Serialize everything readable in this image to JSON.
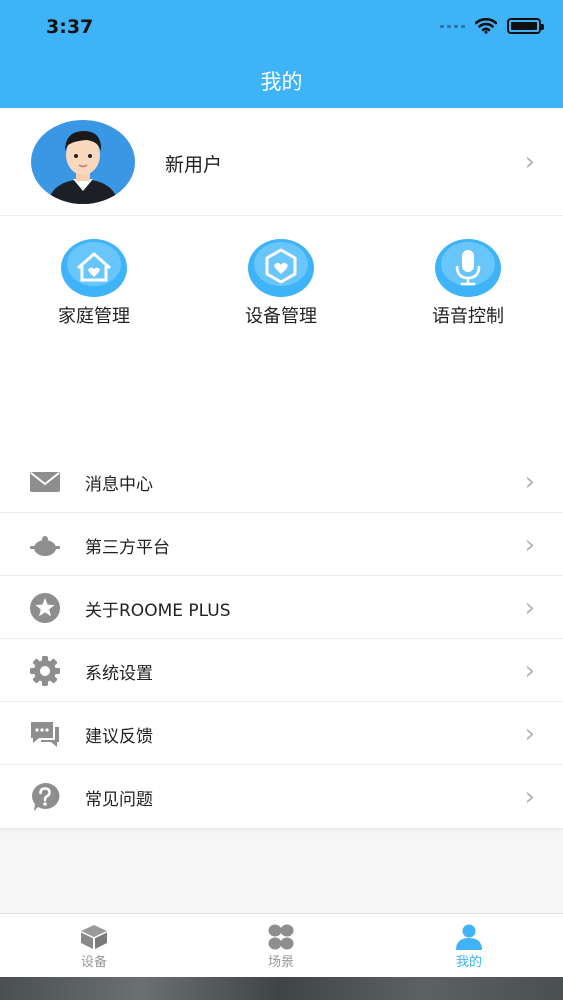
{
  "status_bar": {
    "time": "3:37"
  },
  "header": {
    "title": "我的"
  },
  "profile": {
    "username": "新用户"
  },
  "quick_actions": [
    {
      "label": "家庭管理",
      "icon": "home-heart-icon"
    },
    {
      "label": "设备管理",
      "icon": "device-heart-icon"
    },
    {
      "label": "语音控制",
      "icon": "microphone-icon"
    }
  ],
  "menu": [
    {
      "label": "消息中心",
      "icon": "mail-icon"
    },
    {
      "label": "第三方平台",
      "icon": "platform-icon"
    },
    {
      "label": "关于ROOME PLUS",
      "icon": "star-icon"
    },
    {
      "label": "系统设置",
      "icon": "gear-icon"
    },
    {
      "label": "建议反馈",
      "icon": "feedback-icon"
    },
    {
      "label": "常见问题",
      "icon": "question-icon"
    }
  ],
  "tabbar": {
    "items": [
      {
        "label": "设备",
        "icon": "box-icon"
      },
      {
        "label": "场景",
        "icon": "scene-icon"
      },
      {
        "label": "我的",
        "icon": "user-icon"
      }
    ],
    "active_index": 2
  },
  "colors": {
    "accent": "#3fb3f7",
    "icon_gray": "#8e8e8e",
    "chevron": "#b5b5b5"
  }
}
